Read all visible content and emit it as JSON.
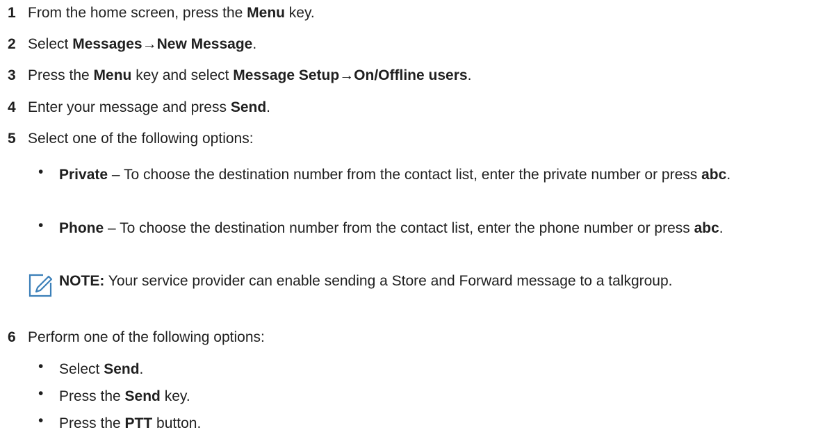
{
  "steps": [
    {
      "num": "1",
      "parts": [
        "From the home screen, press the ",
        "Menu",
        " key."
      ]
    },
    {
      "num": "2",
      "parts": [
        "Select ",
        "Messages→New Message",
        "."
      ]
    },
    {
      "num": "3",
      "parts": [
        "Press the ",
        "Menu",
        " key and select ",
        "Message Setup→On/Offline users",
        "."
      ]
    },
    {
      "num": "4",
      "parts": [
        "Enter your message and press ",
        "Send",
        "."
      ]
    },
    {
      "num": "5",
      "parts": [
        "Select one of the following options:"
      ]
    },
    {
      "num": "6",
      "parts": [
        "Perform one of the following options:"
      ]
    }
  ],
  "step5_options": [
    {
      "label": "Private",
      "text": " – To choose the destination number from the contact list, enter the private number or press ",
      "key": "abc",
      "end": "."
    },
    {
      "label": "Phone",
      "text": " – To choose the destination number from the contact list, enter the phone number or press ",
      "key": "abc",
      "end": "."
    }
  ],
  "note": {
    "label": "NOTE:",
    "text": " Your service provider can enable sending a Store and Forward message to a talkgroup."
  },
  "step6_options": [
    {
      "pre": "Select ",
      "bold": "Send",
      "post": "."
    },
    {
      "pre": "Press the ",
      "bold": "Send",
      "post": " key."
    },
    {
      "pre": "Press the ",
      "bold": "PTT",
      "post": " button."
    }
  ],
  "bullet_char": "•",
  "icon_color": "#3a7fb8"
}
